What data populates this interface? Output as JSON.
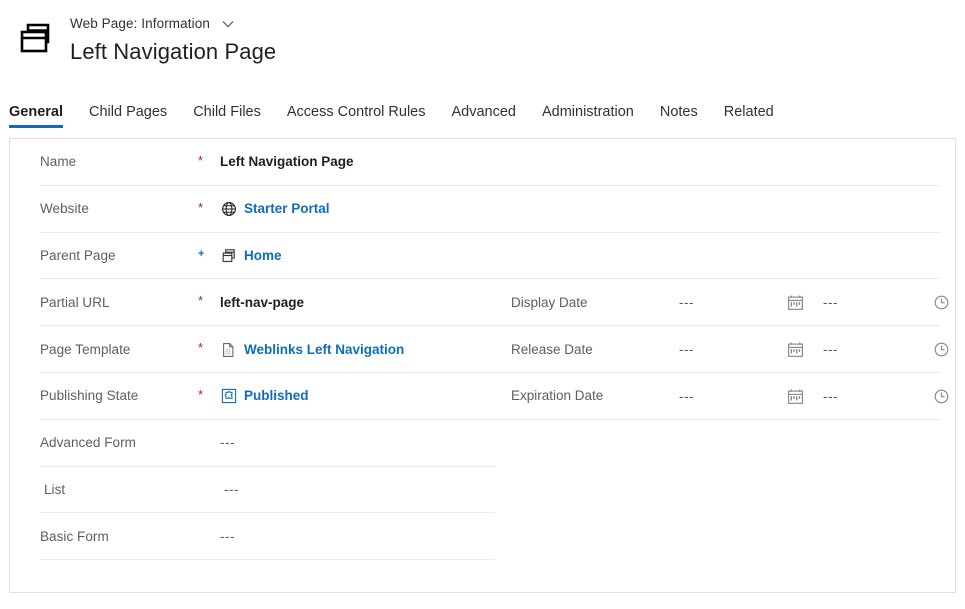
{
  "header": {
    "app_icon": "web-pages-icon",
    "entity_type": "Web Page: Information",
    "dropdown_icon": "chevron-down-icon",
    "record_title": "Left Navigation Page"
  },
  "tabs": [
    {
      "label": "General",
      "selected": true
    },
    {
      "label": "Child Pages",
      "selected": false
    },
    {
      "label": "Child Files",
      "selected": false
    },
    {
      "label": "Access Control Rules",
      "selected": false
    },
    {
      "label": "Advanced",
      "selected": false
    },
    {
      "label": "Administration",
      "selected": false
    },
    {
      "label": "Notes",
      "selected": false
    },
    {
      "label": "Related",
      "selected": false
    }
  ],
  "form": {
    "left_fields": [
      {
        "label": "Name",
        "required_mark": "*",
        "mark_kind": "asterisk",
        "value": "Left Navigation Page",
        "value_kind": "bold",
        "icon": ""
      },
      {
        "label": "Website",
        "required_mark": "*",
        "mark_kind": "asterisk",
        "value": "Starter Portal",
        "value_kind": "link",
        "icon": "globe-icon"
      },
      {
        "label": "Parent Page",
        "required_mark": "+",
        "mark_kind": "plus",
        "value": "Home",
        "value_kind": "link",
        "icon": "web-page-icon"
      },
      {
        "label": "Partial URL",
        "required_mark": "*",
        "mark_kind": "asterisk",
        "value": "left-nav-page",
        "value_kind": "bold",
        "icon": ""
      },
      {
        "label": "Page Template",
        "required_mark": "*",
        "mark_kind": "asterisk",
        "value": "Weblinks Left Navigation",
        "value_kind": "link",
        "icon": "page-template-icon"
      },
      {
        "label": "Publishing State",
        "required_mark": "*",
        "mark_kind": "asterisk",
        "value": "Published",
        "value_kind": "link",
        "icon": "publishing-state-icon"
      },
      {
        "label": "Advanced Form",
        "required_mark": "",
        "mark_kind": "none",
        "value": "---",
        "value_kind": "muted",
        "icon": ""
      },
      {
        "label": "List",
        "required_mark": "",
        "mark_kind": "none",
        "value": "---",
        "value_kind": "muted",
        "icon": ""
      },
      {
        "label": "Basic Form",
        "required_mark": "",
        "mark_kind": "none",
        "value": "---",
        "value_kind": "muted",
        "icon": ""
      }
    ],
    "date_fields": [
      {
        "label": "Display Date",
        "date_value": "---",
        "date_icon": "calendar-icon",
        "time_value": "---",
        "time_icon": "clock-icon"
      },
      {
        "label": "Release Date",
        "date_value": "---",
        "date_icon": "calendar-icon",
        "time_value": "---",
        "time_icon": "clock-icon"
      },
      {
        "label": "Expiration Date",
        "date_value": "---",
        "date_icon": "calendar-icon",
        "time_value": "---",
        "time_icon": "clock-icon"
      }
    ]
  },
  "colors": {
    "accent": "#0f6cbd",
    "required": "#a4262c",
    "label_text": "#605e5c",
    "value_text": "#201f1e",
    "divider": "#edebe9",
    "card_border": "#e1dfdd"
  }
}
